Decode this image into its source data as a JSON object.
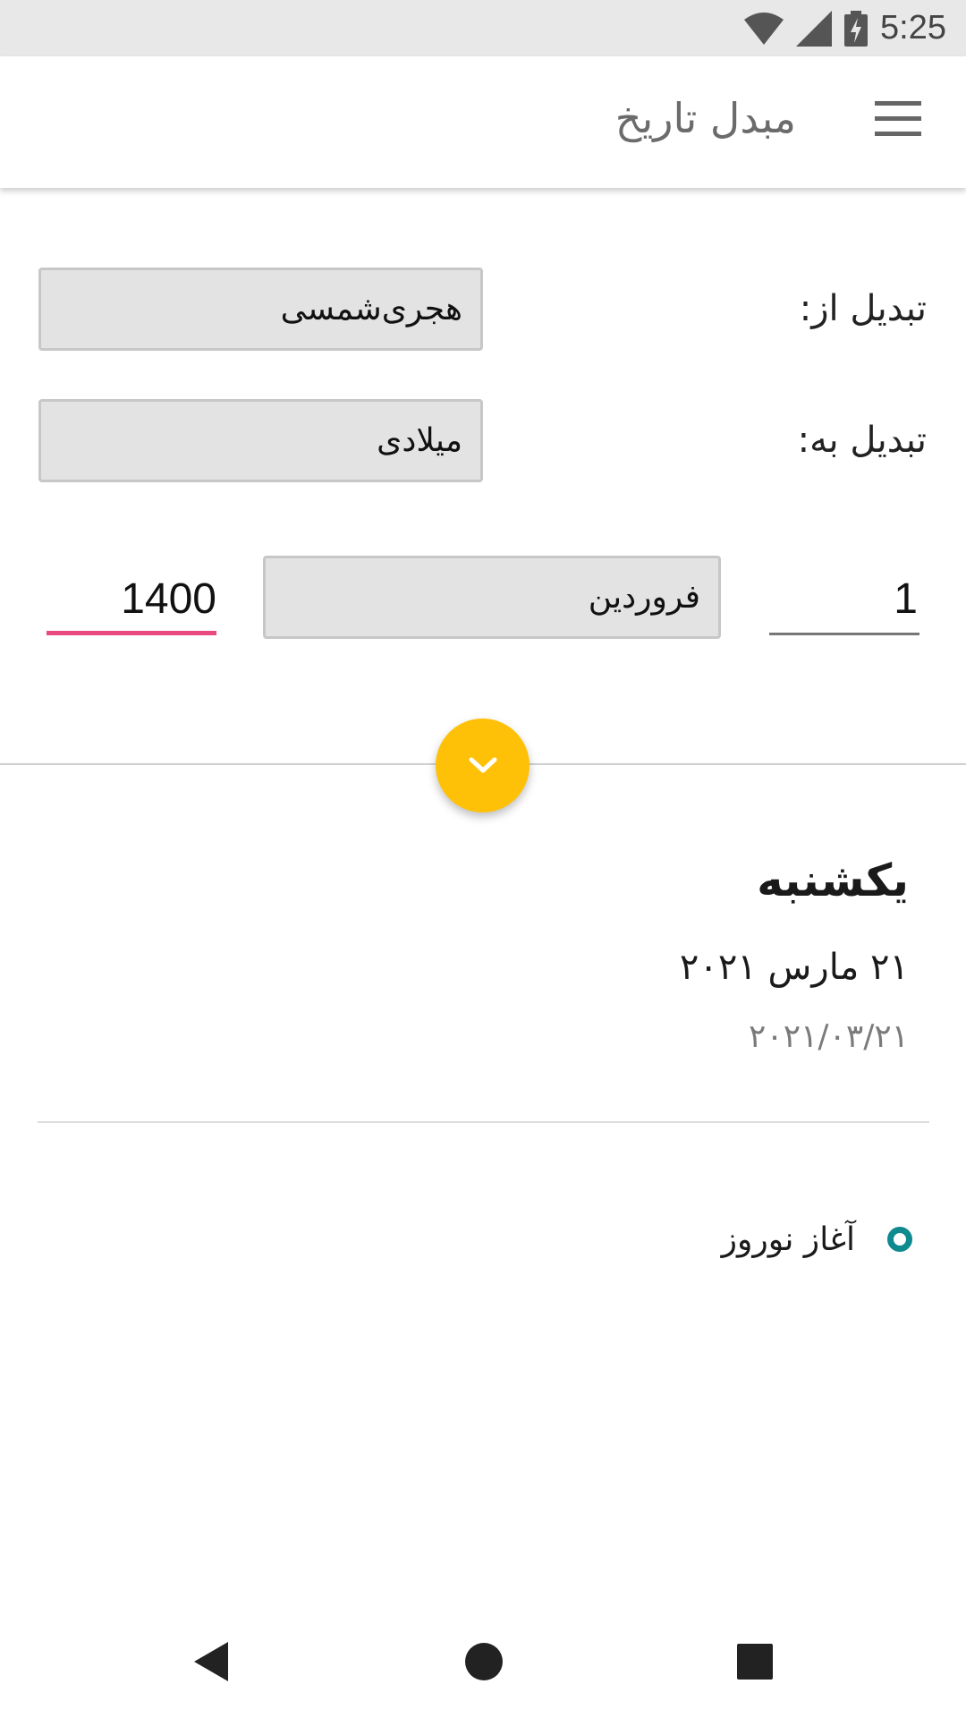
{
  "status_bar": {
    "time": "5:25",
    "icons": [
      "wifi-icon",
      "signal-icon",
      "battery-charging-icon"
    ]
  },
  "app_bar": {
    "title": "مبدل تاریخ",
    "menu_icon": "menu-icon"
  },
  "form": {
    "from_label": "تبدیل از:",
    "from_value": "هجری‌شمسی",
    "to_label": "تبدیل به:",
    "to_value": "میلادی",
    "day_value": "1",
    "month_value": "فروردین",
    "year_value": "1400"
  },
  "convert_button": {
    "icon": "chevron-down-icon"
  },
  "result": {
    "weekday": "یکشنبه",
    "date_text": "۲۱ مارس ۲۰۲۱",
    "date_numeric": "۲۰۲۱/۰۳/۲۱"
  },
  "events": [
    {
      "label": "آغاز نوروز"
    }
  ],
  "nav_bar": {
    "icons": [
      "back-icon",
      "home-icon",
      "recents-icon"
    ]
  },
  "colors": {
    "accent_fab": "#ffc107",
    "year_underline": "#e84a80",
    "event_bullet": "#0f8a8f"
  }
}
